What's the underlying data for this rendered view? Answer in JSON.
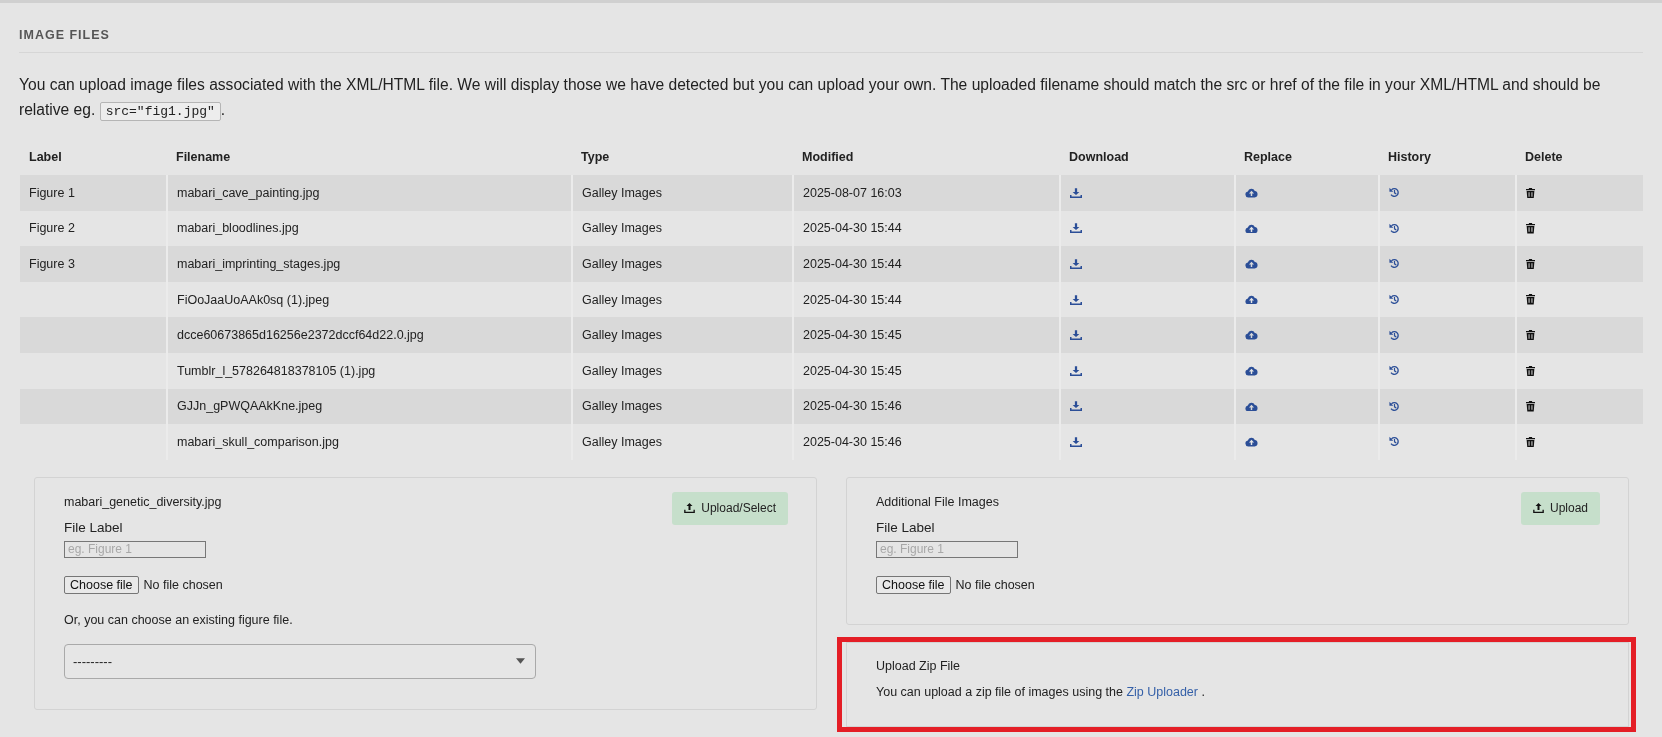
{
  "section": {
    "title": "IMAGE FILES",
    "intro": {
      "before": "You can upload image files associated with the XML/HTML file. We will display those we have detected but you can upload your own. The uploaded filename should match the src or href of the file in your XML/HTML and should be relative eg.",
      "code": "src=\"fig1.jpg\"",
      "after": "."
    }
  },
  "table": {
    "columns": [
      {
        "title": "Label",
        "kind": "label"
      },
      {
        "title": "Filename",
        "kind": "filename"
      },
      {
        "title": "Type",
        "kind": "type"
      },
      {
        "title": "Modified",
        "kind": "modified"
      },
      {
        "title": "Download",
        "kind": "download"
      },
      {
        "title": "Replace",
        "kind": "replace"
      },
      {
        "title": "History",
        "kind": "history"
      },
      {
        "title": "Delete",
        "kind": "delete"
      }
    ],
    "rows": [
      {
        "label": "Figure 1",
        "filename": "mabari_cave_painting.jpg",
        "type": "Galley Images",
        "modified": "2025-08-07 16:03"
      },
      {
        "label": "Figure 2",
        "filename": "mabari_bloodlines.jpg",
        "type": "Galley Images",
        "modified": "2025-04-30 15:44"
      },
      {
        "label": "Figure 3",
        "filename": "mabari_imprinting_stages.jpg",
        "type": "Galley Images",
        "modified": "2025-04-30 15:44"
      },
      {
        "filename": "FiOoJaaUoAAk0sq (1).jpeg",
        "type": "Galley Images",
        "modified": "2025-04-30 15:44"
      },
      {
        "filename": "dcce60673865d16256e2372dccf64d22.0.jpg",
        "type": "Galley Images",
        "modified": "2025-04-30 15:45"
      },
      {
        "filename": "Tumblr_l_578264818378105 (1).jpg",
        "type": "Galley Images",
        "modified": "2025-04-30 15:45"
      },
      {
        "filename": "GJJn_gPWQAAkKne.jpeg",
        "type": "Galley Images",
        "modified": "2025-04-30 15:46"
      },
      {
        "filename": "mabari_skull_comparison.jpg",
        "type": "Galley Images",
        "modified": "2025-04-30 15:46"
      }
    ]
  },
  "upload_panels": [
    {
      "title": "mabari_genetic_diversity.jpg",
      "field_label": "File Label",
      "placeholder": "eg. Figure 1",
      "file_button": "Choose file",
      "file_status": "No file chosen",
      "note": "Or, you can choose an existing figure file.",
      "select_value": "---------",
      "button": "Upload/Select"
    },
    {
      "title": "Additional File Images",
      "field_label": "File Label",
      "placeholder": "eg. Figure 1",
      "file_button": "Choose file",
      "file_status": "No file chosen",
      "button": "Upload"
    }
  ],
  "zip_panel": {
    "title": "Upload Zip File",
    "text": "You can upload a zip file of images using the",
    "link": "Zip Uploader",
    "after": ".",
    "highlighted": true
  }
}
